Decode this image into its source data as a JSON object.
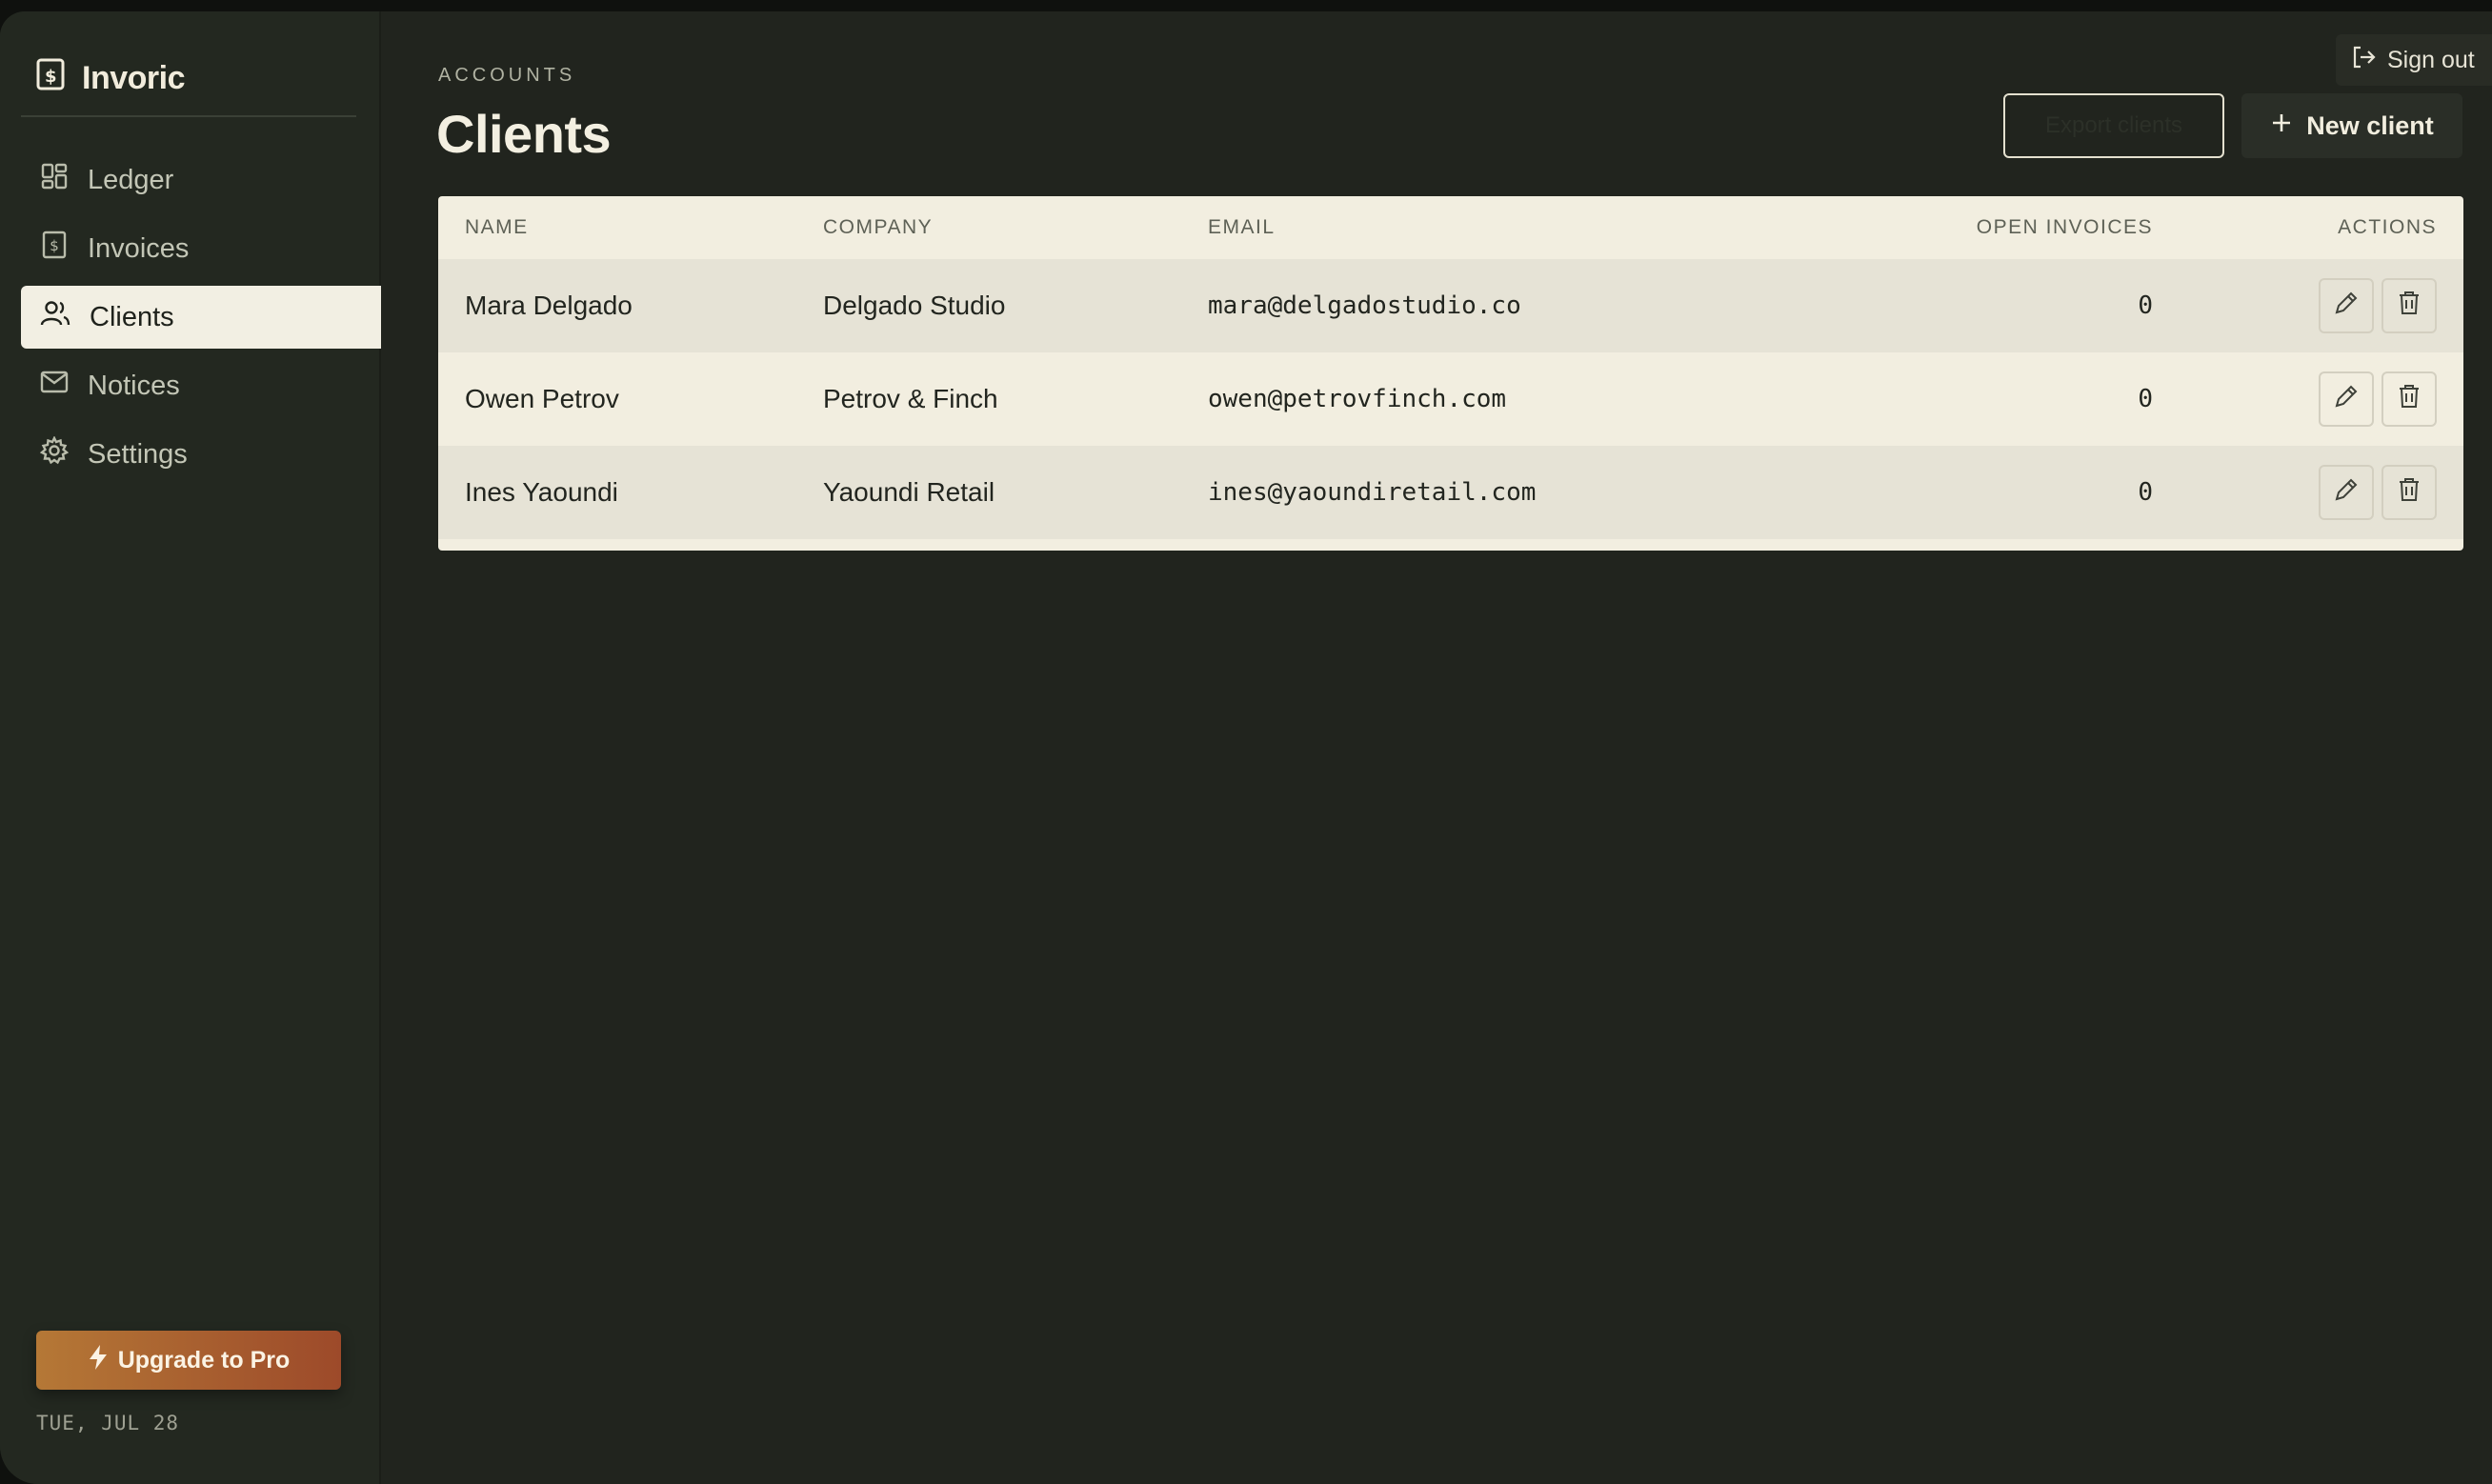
{
  "sidebar": {
    "brand": "Invoric",
    "items": [
      {
        "label": "Ledger",
        "icon": "dashboard-grid-icon",
        "active": false
      },
      {
        "label": "Invoices",
        "icon": "invoice-icon",
        "active": false
      },
      {
        "label": "Clients",
        "icon": "users-icon",
        "active": true
      },
      {
        "label": "Notices",
        "icon": "mail-icon",
        "active": false
      },
      {
        "label": "Settings",
        "icon": "gear-icon",
        "active": false
      }
    ],
    "upgrade_label": "Upgrade to Pro",
    "date": "TUE, JUL 28"
  },
  "header": {
    "eyebrow": "ACCOUNTS",
    "title": "Clients",
    "signout_label": "Sign out",
    "outline_button_label": "Export clients",
    "new_client_label": "New client"
  },
  "table": {
    "columns": [
      "NAME",
      "COMPANY",
      "EMAIL",
      "OPEN INVOICES",
      "ACTIONS"
    ],
    "rows": [
      {
        "name": "Mara Delgado",
        "company": "Delgado Studio",
        "email": "mara@delgadostudio.co",
        "open_invoices": "0"
      },
      {
        "name": "Owen Petrov",
        "company": "Petrov & Finch",
        "email": "owen@petrovfinch.com",
        "open_invoices": "0"
      },
      {
        "name": "Ines Yaoundi",
        "company": "Yaoundi Retail",
        "email": "ines@yaoundiretail.com",
        "open_invoices": "0"
      }
    ]
  },
  "colors": {
    "background": "#21241e",
    "sidebar": "#232820",
    "active_nav": "#f2efe3",
    "table_bg": "#f2eee0",
    "upgrade_start": "#b57836",
    "upgrade_end": "#9d4a2a"
  }
}
